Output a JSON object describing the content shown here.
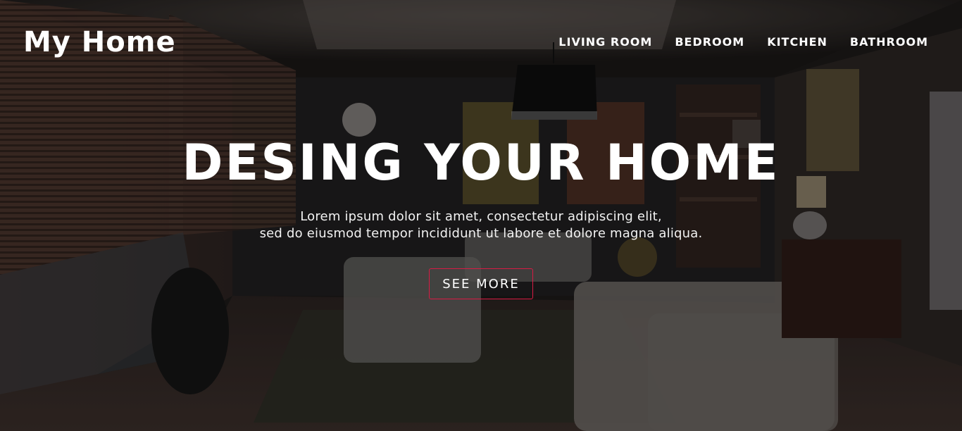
{
  "header": {
    "logo": "My Home",
    "nav": [
      {
        "label": "LIVING ROOM"
      },
      {
        "label": "BEDROOM"
      },
      {
        "label": "KITCHEN"
      },
      {
        "label": "BATHROOM"
      }
    ]
  },
  "hero": {
    "title": "DESING YOUR HOME",
    "subtitle_line1": "Lorem ipsum dolor sit amet, consectetur adipiscing elit,",
    "subtitle_line2": "sed do eiusmod tempor incididunt ut labore et dolore magna aliqua.",
    "cta_label": "SEE MORE"
  },
  "colors": {
    "cta_border": "#d81b44",
    "text": "#ffffff",
    "overlay": "#000000"
  }
}
